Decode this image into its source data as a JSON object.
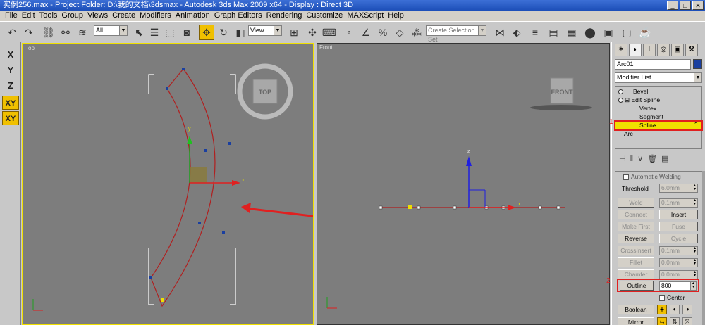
{
  "window": {
    "title": "实例256.max - Project Folder: D:\\我的文档\\3dsmax - Autodesk 3ds Max 2009 x64 - Display : Direct 3D",
    "min": "_",
    "max": "□",
    "close": "✕"
  },
  "menu": [
    "File",
    "Edit",
    "Tools",
    "Group",
    "Views",
    "Create",
    "Modifiers",
    "Animation",
    "Graph Editors",
    "Rendering",
    "Customize",
    "MAXScript",
    "Help"
  ],
  "toolbar": {
    "selection_filter": "All",
    "ref_coord": "View",
    "named_selection_placeholder": "Create Selection Set",
    "icons": [
      "undo-icon",
      "redo-icon",
      "select-link-icon",
      "unlink-icon",
      "bind-spacewarp-icon",
      "select-icon",
      "select-region-icon",
      "window-crossing-icon",
      "select-by-name-icon",
      "move-icon",
      "rotate-icon",
      "scale-icon",
      "pivot-icon",
      "select-manipulate-icon",
      "keyboard-shortcut-icon",
      "snap-icon",
      "angle-snap-icon",
      "percent-snap-icon",
      "spinner-snap-icon",
      "edit-named-sel-icon",
      "mirror-icon",
      "align-icon",
      "layer-manager-icon",
      "curve-editor-icon",
      "schematic-view-icon",
      "material-editor-icon",
      "render-setup-icon",
      "render-frame-icon",
      "quick-render-icon"
    ]
  },
  "axis_constraints": [
    "X",
    "Y",
    "Z",
    "XY",
    "XY"
  ],
  "viewports": {
    "top": {
      "label": "Top",
      "cube_label": "TOP",
      "x_axis": "x",
      "y_axis": "y"
    },
    "front": {
      "label": "Front",
      "cube_label": "FRONT",
      "x_axis": "x",
      "z_axis": "z"
    }
  },
  "command_panel": {
    "object_name": "Arc01",
    "object_color": "#1a3fa0",
    "modifier_list": "Modifier List",
    "stack": [
      {
        "label": "Bevel",
        "level": 0
      },
      {
        "label": "Edit Spline",
        "level": 0
      },
      {
        "label": "Vertex",
        "level": 2
      },
      {
        "label": "Segment",
        "level": 2
      },
      {
        "label": "Spline",
        "level": 2,
        "selected": true
      },
      {
        "label": "Arc",
        "level": 1
      }
    ],
    "marker_1": "1",
    "marker_2": "2",
    "auto_welding_label": "Automatic Welding",
    "threshold_label": "Threshold",
    "threshold_value": "6.0mm",
    "weld_label": "Weld",
    "weld_value": "0.1mm",
    "connect_label": "Connect",
    "insert_label": "Insert",
    "make_first_label": "Make First",
    "fuse_label": "Fuse",
    "reverse_label": "Reverse",
    "cycle_label": "Cycle",
    "crossinsert_label": "CrossInsert",
    "crossinsert_value": "0.1mm",
    "fillet_label": "Fillet",
    "fillet_value": "0.0mm",
    "chamfer_label": "Chamfer",
    "chamfer_value": "0.0mm",
    "outline_label": "Outline",
    "outline_value": "800",
    "center_label": "Center",
    "boolean_label": "Boolean",
    "mirror_label": "Mirror"
  }
}
